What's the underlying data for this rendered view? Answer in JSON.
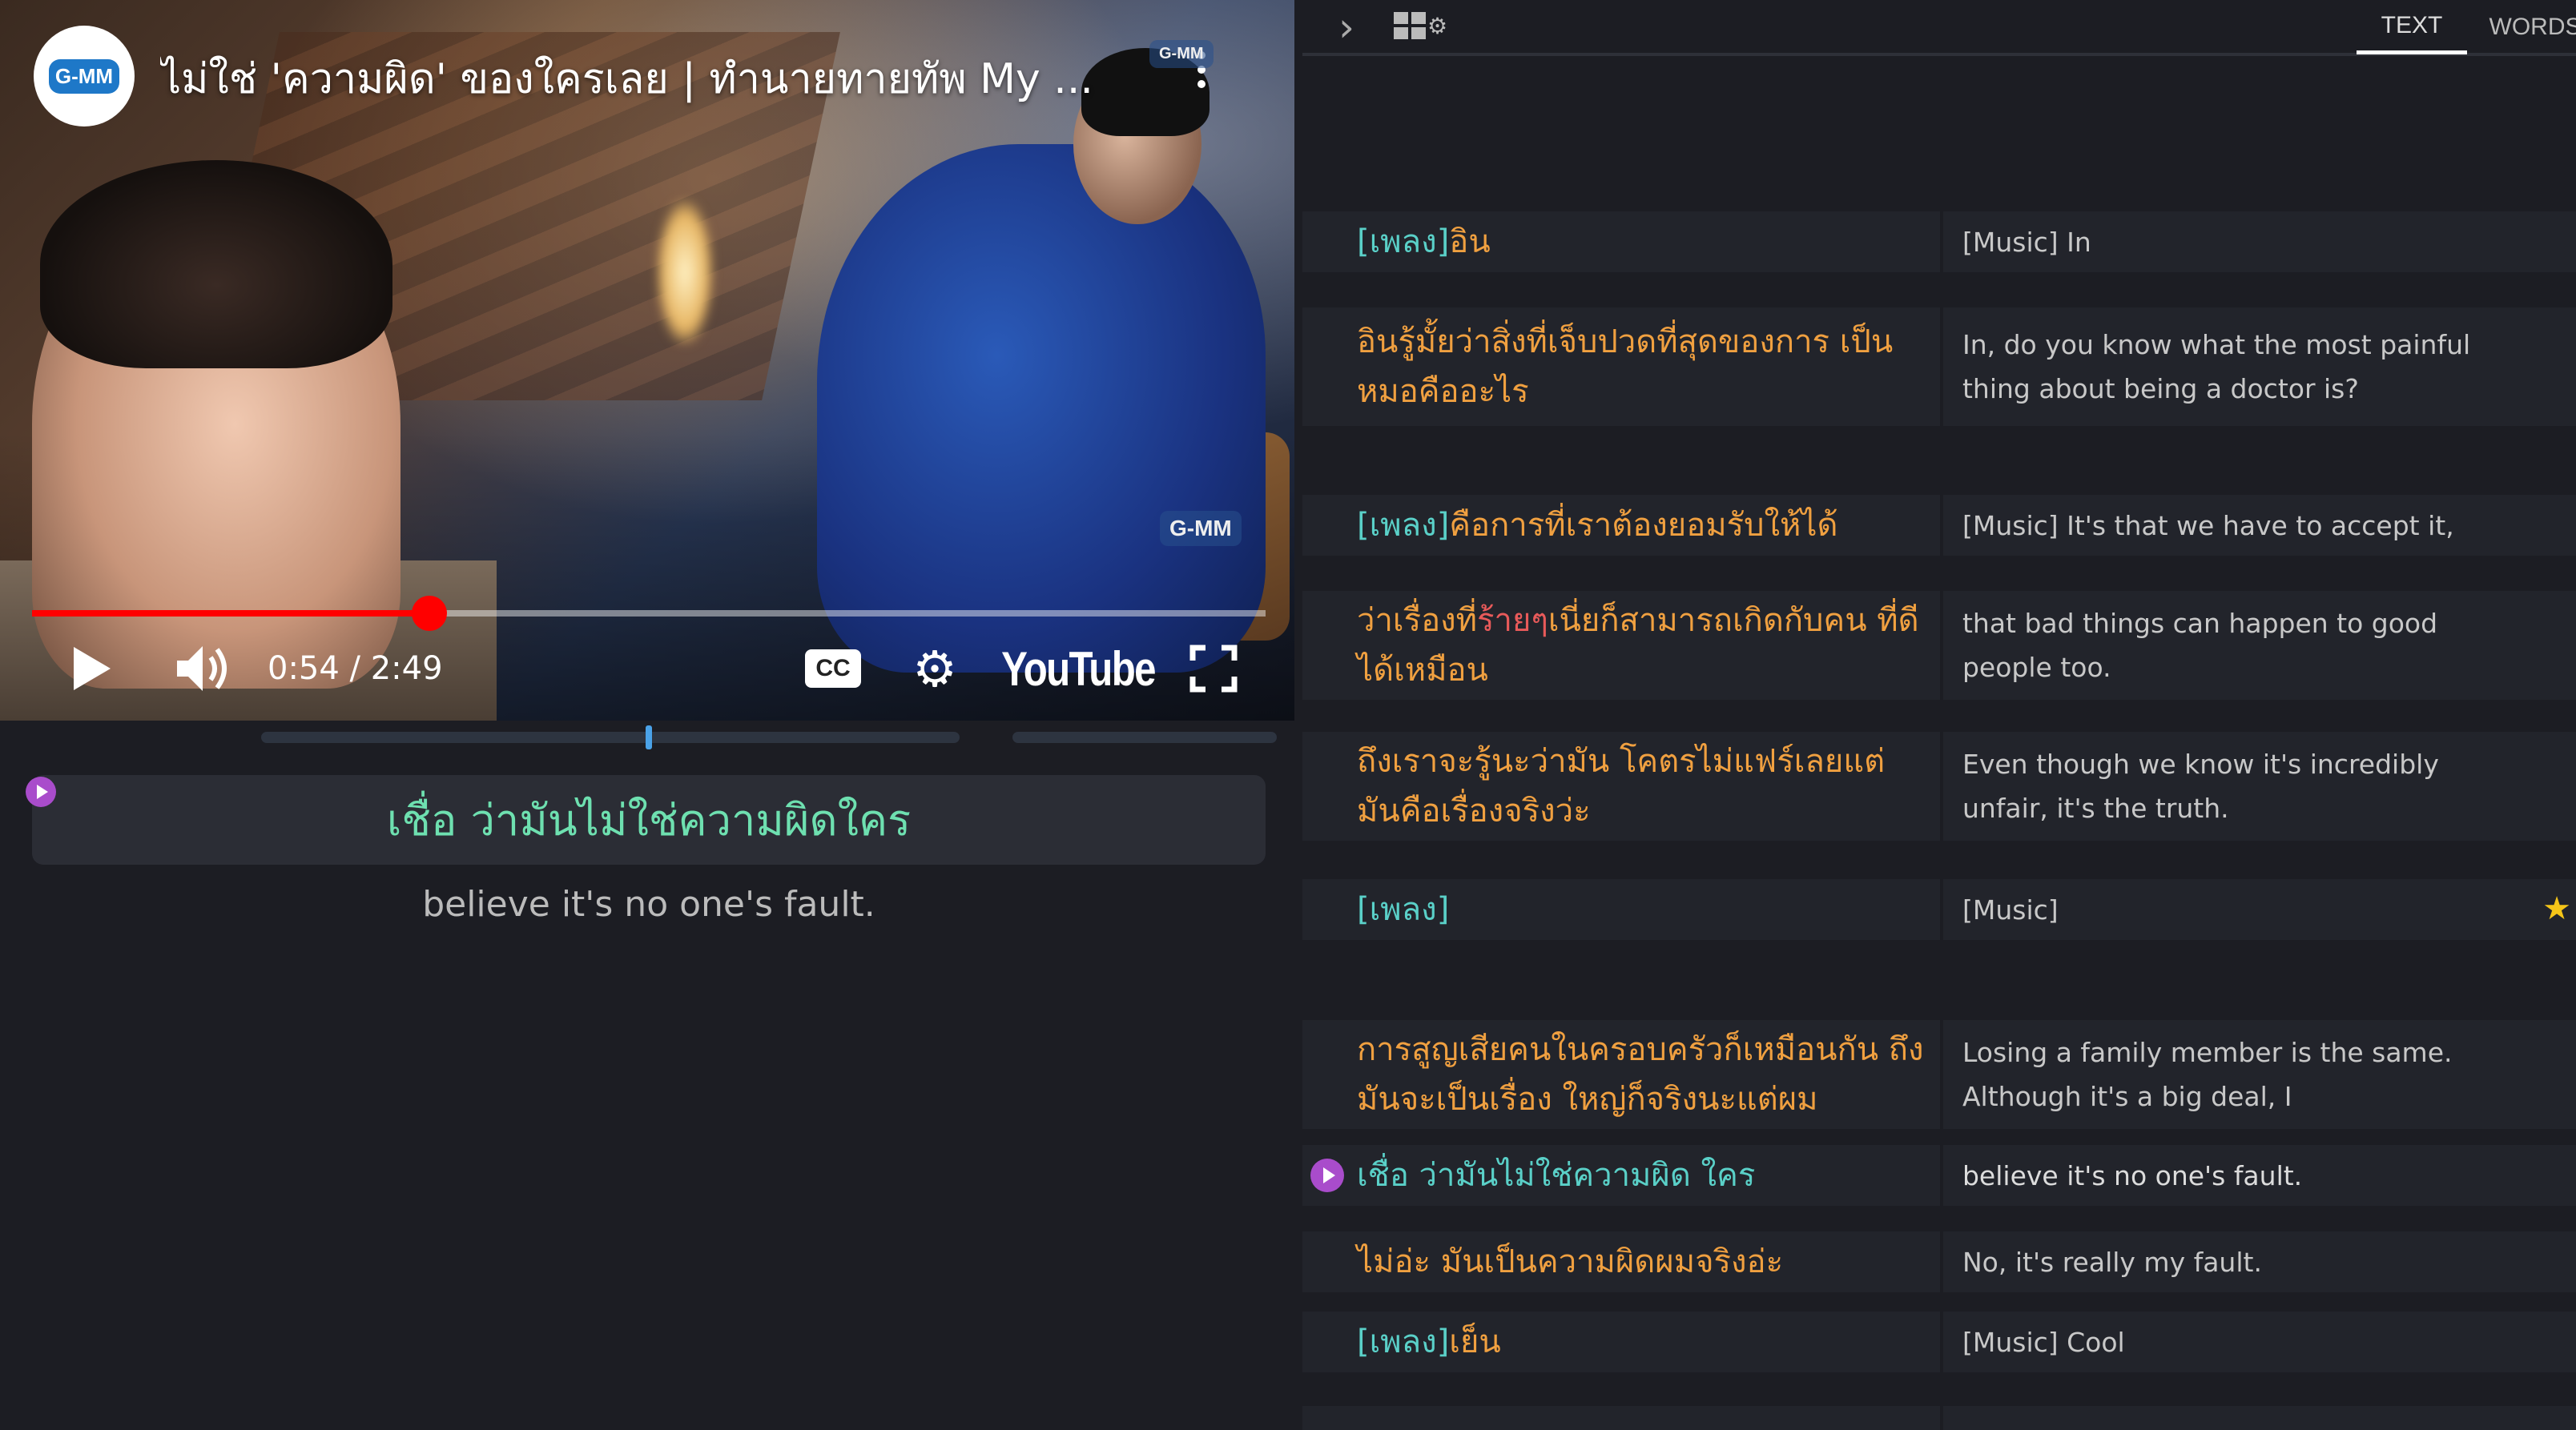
{
  "player": {
    "title": "ไม่ใช่ 'ความผิด' ของใครเลย | ทำนายทายทัพ My ...",
    "channel_logo_text": "G-MM",
    "watermark_top": "G-MM",
    "watermark_mid": "G-MM",
    "progress": 0.322,
    "time_text": "0:54 / 2:49",
    "cc_label": "CC",
    "brand": "YouTube",
    "icons": {
      "play": "play-icon",
      "volume": "volume-icon",
      "settings": "gear-icon",
      "fullscreen": "fullscreen-icon",
      "more": "more-vertical-icon"
    },
    "accent_color": "#ff0000"
  },
  "current_caption": {
    "thai": "เชื่อ ว่ามันไม่ใช่ความผิดใคร",
    "english": "believe it's no one's fault."
  },
  "panel": {
    "tabs": [
      "TEXT",
      "WORDS"
    ],
    "active_tab": "TEXT",
    "rows": [
      {
        "thai_tag": "[เพลง]",
        "thai": " อิน",
        "english": "[Music] In"
      },
      {
        "thai_tag": "",
        "thai": "อินรู้มั้ยว่าสิ่งที่เจ็บปวดที่สุดของการ เป็นหมอคืออะไร",
        "english": "In, do you know what the most painful thing about being a doctor is?"
      },
      {
        "thai_tag": "[เพลง]",
        "thai": " คือการที่เราต้องยอมรับให้ได้",
        "english": "[Music] It's that we have to accept it,"
      },
      {
        "thai_tag": "",
        "thai_a": "ว่าเรื่องที่",
        "thai_hl": "ร้ายๆ",
        "thai_b": "เนี่ยก็สามารถเกิดกับคน ที่ดีได้เหมือน",
        "english": "that bad things can happen to good people too."
      },
      {
        "thai_tag": "",
        "thai": "ถึงเราจะรู้นะว่ามัน โคตรไม่แฟร์เลยแต่มันคือเรื่องจริงว่ะ",
        "english": "Even though we know it's incredibly unfair, it's the truth."
      },
      {
        "thai_tag": "[เพลง]",
        "thai": "",
        "english": "[Music]",
        "starred": true
      },
      {
        "thai_tag": "",
        "thai": "การสูญเสียคนในครอบครัวก็เหมือนกัน ถึงมันจะเป็นเรื่อง ใหญ่ก็จริงนะแต่ผม",
        "english": "Losing a family member is the same. Although it's a big deal, I"
      },
      {
        "thai_tag": "",
        "thai": "เชื่อ ว่ามันไม่ใช่ความผิด ใคร",
        "english": "believe it's no one's fault.",
        "active": true
      },
      {
        "thai_tag": "",
        "thai": "ไม่อ่ะ มันเป็นความผิดผมจริงอ่ะ",
        "english": "No, it's really my fault."
      },
      {
        "thai_tag": "[เพลง]",
        "thai": " เย็น",
        "english": "[Music] Cool"
      }
    ]
  }
}
